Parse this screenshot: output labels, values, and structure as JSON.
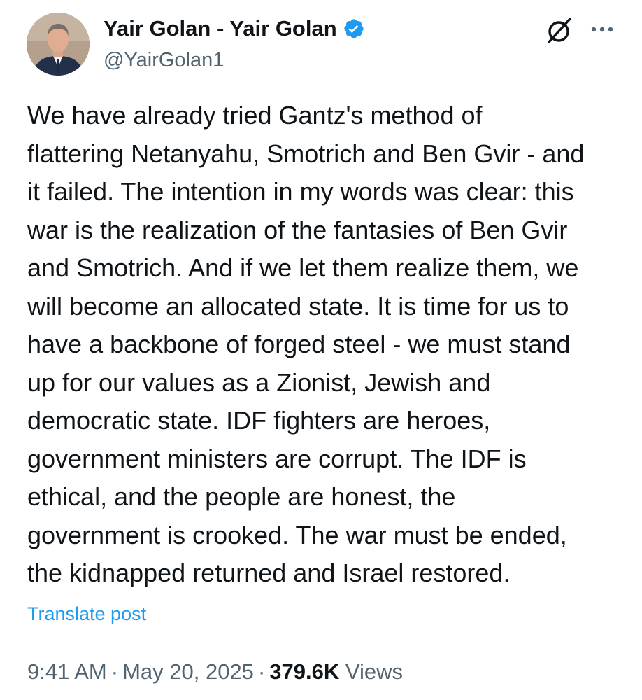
{
  "author": {
    "display_name": "Yair Golan - Yair Golan",
    "handle": "@YairGolan1",
    "verified": true,
    "verified_color": "#1d9bf0",
    "avatar": "profile-photo"
  },
  "actions": {
    "grok_icon": "slashed-circle-icon",
    "more_icon": "ellipsis-icon"
  },
  "post": {
    "text": "We have already tried Gantz's method of\nflattering Netanyahu, Smotrich and Ben Gvir - and\nit failed. The intention in my words was clear: this\nwar is the realization of the fantasies of Ben Gvir\nand Smotrich. And if we let them realize them, we\nwill become an allocated state. It is time for us to\nhave a backbone of forged steel - we must stand\nup for our values as a Zionist, Jewish and\ndemocratic state. IDF fighters are heroes,\ngovernment ministers are corrupt. The IDF is\nethical, and the people are honest, the\ngovernment is crooked. The war must be ended,\nthe kidnapped returned and Israel restored.",
    "translate_label": "Translate post"
  },
  "meta": {
    "time": "9:41 AM",
    "separator": "·",
    "date": "May 20, 2025",
    "views_count": "379.6K",
    "views_label": "Views"
  },
  "colors": {
    "text": "#0f1419",
    "secondary": "#536471",
    "link": "#1d9bf0"
  }
}
